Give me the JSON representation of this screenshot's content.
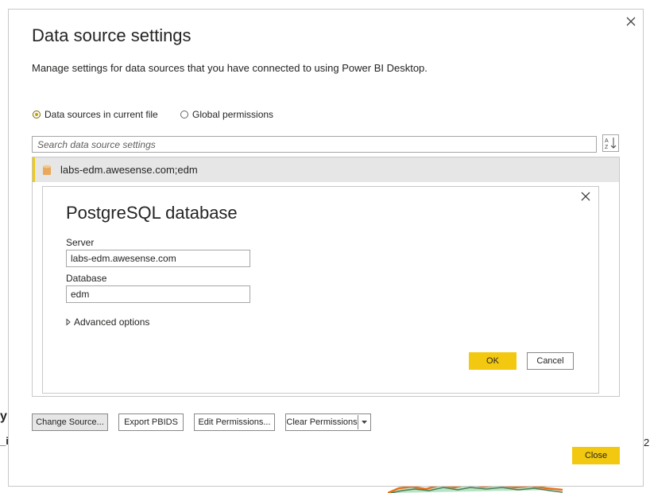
{
  "background": {
    "fragment_y": "y",
    "fragment_i": "_i",
    "fragment_2": "2"
  },
  "dialog": {
    "title": "Data source settings",
    "description": "Manage settings for data sources that you have connected to using Power BI Desktop.",
    "scope_options": [
      {
        "label": "Data sources in current file",
        "selected": true
      },
      {
        "label": "Global permissions",
        "selected": false
      }
    ],
    "search": {
      "placeholder": "Search data source settings",
      "value": ""
    },
    "sort_icon": "sort-az-icon",
    "data_sources": [
      {
        "label": "labs-edm.awesense.com;edm",
        "icon": "database-icon",
        "selected": true
      }
    ],
    "buttons": {
      "change_source": "Change Source...",
      "export_pbids": "Export PBIDS",
      "edit_permissions": "Edit Permissions...",
      "clear_permissions": "Clear Permissions",
      "close": "Close"
    }
  },
  "pg_dialog": {
    "title": "PostgreSQL database",
    "server_label": "Server",
    "server_value": "labs-edm.awesense.com",
    "database_label": "Database",
    "database_value": "edm",
    "advanced_label": "Advanced options",
    "ok_label": "OK",
    "cancel_label": "Cancel"
  },
  "colors": {
    "accent": "#f2c811",
    "selected_row": "#e6e6e6",
    "border": "#c8c8c8",
    "text": "#252423"
  }
}
